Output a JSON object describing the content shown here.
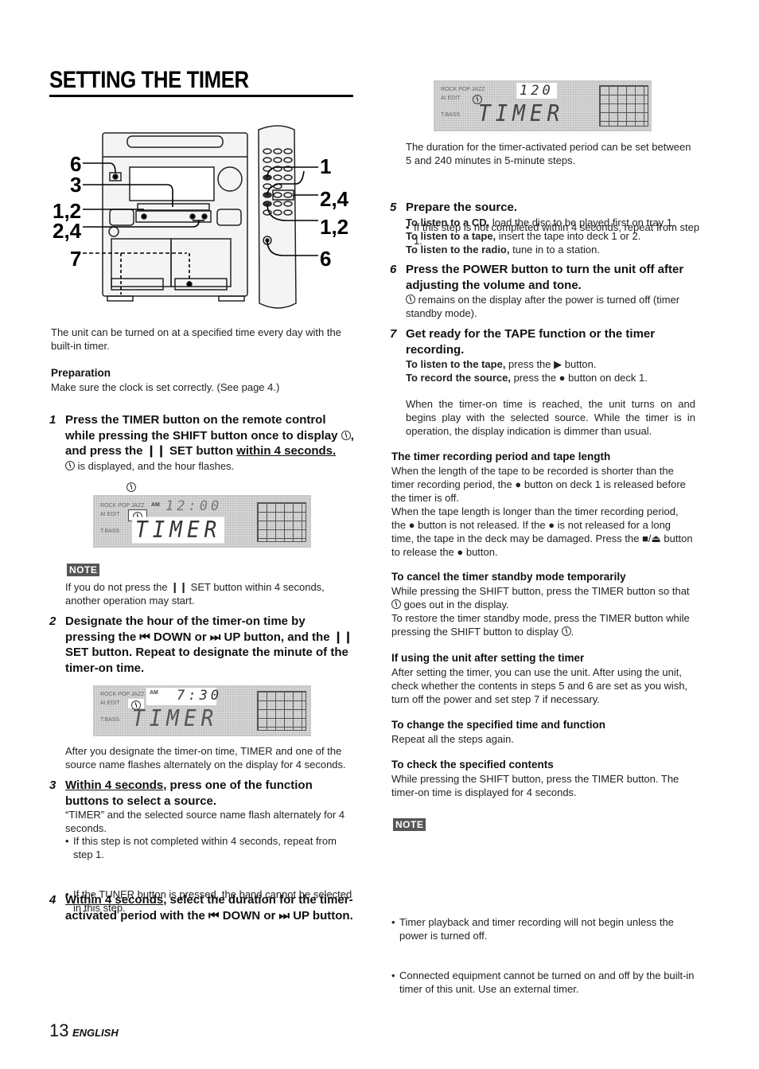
{
  "page": {
    "title": "SETTING THE TIMER",
    "page_number": "13",
    "language": "ENGLISH"
  },
  "figure": {
    "callouts_left": [
      "6",
      "3",
      "1,2",
      "2,4",
      "7"
    ],
    "callouts_right": [
      "1",
      "2,4",
      "1,2",
      "6"
    ]
  },
  "intro": {
    "text": "The unit can be turned on at a specified time every day with the built-in timer.",
    "preparation_heading": "Preparation",
    "preparation_text": "Make sure the clock is set correctly. (See page 4.)"
  },
  "steps": [
    {
      "number": "1",
      "heading_pre": "Press the TIMER button on the remote control while pressing the SHIFT button once to display ",
      "heading_mid": ", and press the ",
      "heading_set": " SET button ",
      "heading_underlined": "within 4 seconds.",
      "body": " is displayed, and the hour flashes.",
      "display": {
        "labels": [
          "ROCK POP JAZZ",
          "AI EDIT",
          "T.BASS"
        ],
        "am": "AM",
        "digits": "12:00",
        "main": "TIMER"
      },
      "note_badge": "NOTE",
      "note_pre": "If you do not press the ",
      "note_post": " SET button within 4 seconds, another operation may start."
    },
    {
      "number": "2",
      "heading": "Designate the hour of the timer-on time by pressing the ⏮ DOWN or ⏭ UP button, and the ❙❙ SET button. Repeat to designate the minute of the timer-on time.",
      "display": {
        "labels": [
          "ROCK POP JAZZ",
          "AI EDIT",
          "T.BASS"
        ],
        "am": "AM",
        "digits": "7:30",
        "main": "TIMER"
      },
      "body": "After you designate the timer-on time, TIMER and one of the source name flashes alternately on the display for 4 seconds."
    },
    {
      "number": "3",
      "heading_underlined": "Within 4 seconds",
      "heading_rest": ", press one of the function buttons to select a source.",
      "body": "“TIMER” and the selected source name flash alternately for 4 seconds.",
      "bullets": [
        "If this step is not completed within 4 seconds, repeat from step 1.",
        "If the TUNER button is pressed, the band cannot be selected in this step."
      ]
    },
    {
      "number": "4",
      "heading_underlined": "Within 4 seconds",
      "heading_rest": ", select the duration for the timer-activated period with the ⏮ DOWN or ⏭ UP button.",
      "display": {
        "labels": [
          "ROCK POP JAZZ",
          "AI EDIT",
          "T.BASS"
        ],
        "digits": "120",
        "main": "TIMER"
      },
      "body": "The duration for the timer-activated period can be set between 5 and 240 minutes in 5-minute steps.",
      "bullets": [
        "If this step is not completed within 4 seconds, repeat from step 1."
      ]
    },
    {
      "number": "5",
      "heading": "Prepare the source.",
      "lines": [
        {
          "bold": "To listen to a CD,",
          "rest": " load the disc to be played first on tray 1."
        },
        {
          "bold": "To listen to a tape,",
          "rest": " insert the tape into deck 1 or 2."
        },
        {
          "bold": "To listen to the radio,",
          "rest": " tune in to a station."
        }
      ]
    },
    {
      "number": "6",
      "heading": "Press the POWER button to turn the unit off after adjusting the volume and tone.",
      "body": " remains on the display after the power is turned off (timer standby mode)."
    },
    {
      "number": "7",
      "heading": "Get ready for the TAPE function or the timer recording.",
      "lines": [
        {
          "bold": "To listen to the tape,",
          "rest": " press the ▶ button."
        },
        {
          "bold": "To record the source,",
          "rest": " press the ● button on deck 1."
        }
      ],
      "after": "When the timer-on time is reached, the unit turns on and begins play with the selected source. While the timer is in operation, the display indication is dimmer than usual."
    }
  ],
  "sections": [
    {
      "heading": "The timer recording period and tape length",
      "body": "When the length of the tape to be recorded is shorter than the timer recording period, the ● button on deck 1 is released before the timer is off.\nWhen the tape length is longer than the timer recording period, the ● button is not released. If the ● is not released for a long time, the tape in the deck may be damaged. Press the ■/⏏ button to release the ● button."
    },
    {
      "heading": "To cancel the timer standby mode temporarily",
      "body_1_pre": "While pressing the SHIFT button, press the TIMER button so that ",
      "body_1_post": " goes out in the display.",
      "body_2_pre": "To restore the timer standby mode, press the TIMER button while pressing the SHIFT button to display ",
      "body_2_post": "."
    },
    {
      "heading": "If using the unit after setting the timer",
      "body": "After setting the timer, you can use the unit.  After using the unit, check whether the contents in steps 5 and 6 are set as you wish, turn off the power and set step 7 if necessary."
    },
    {
      "heading": "To change the specified time and function",
      "body": "Repeat all the steps again."
    },
    {
      "heading": "To check the specified contents",
      "body": "While pressing the SHIFT button, press the TIMER button.  The timer-on time is displayed for 4 seconds."
    }
  ],
  "final_note": {
    "badge": "NOTE",
    "bullets": [
      "Timer playback and timer recording will not begin unless the power is turned off.",
      "Connected equipment cannot be turned on and off by the built-in timer of this unit. Use an external timer."
    ]
  },
  "glyphs": {
    "pause": "❙❙"
  }
}
